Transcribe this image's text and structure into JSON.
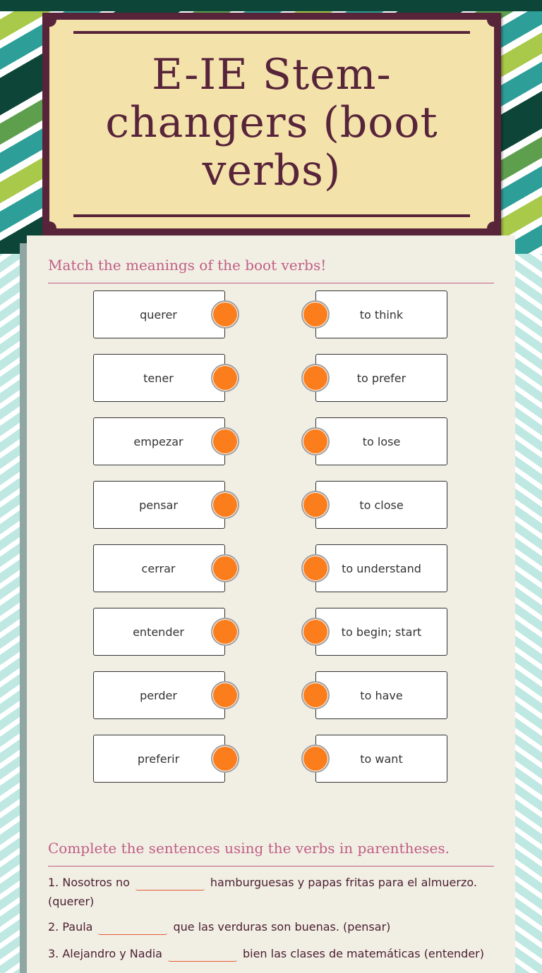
{
  "title": "E-IE Stem-changers (boot verbs)",
  "colors": {
    "title_frame": "#58243a",
    "title_bg": "#f3e3ab",
    "section_heading": "#c05e84",
    "match_dot": "#fc7d1b",
    "blank_underline": "#e85a35"
  },
  "matching": {
    "heading": "Match the meanings of the boot verbs!",
    "left": [
      "querer",
      "tener",
      "empezar",
      "pensar",
      "cerrar",
      "entender",
      "perder",
      "preferir"
    ],
    "right": [
      "to think",
      "to prefer",
      "to lose",
      "to close",
      "to understand",
      "to begin; start",
      "to have",
      "to want"
    ]
  },
  "sentences": {
    "heading": "Complete the sentences using the verbs in parentheses.",
    "items": [
      {
        "before": "1. Nosotros no",
        "after": "hamburguesas y papas fritas para el almuerzo. (querer)",
        "value": ""
      },
      {
        "before": "2. Paula",
        "after": "que las verduras son buenas. (pensar)",
        "value": ""
      },
      {
        "before": "3. Alejandro y Nadia",
        "after": "bien las clases de matemáticas (entender)",
        "value": ""
      }
    ]
  }
}
